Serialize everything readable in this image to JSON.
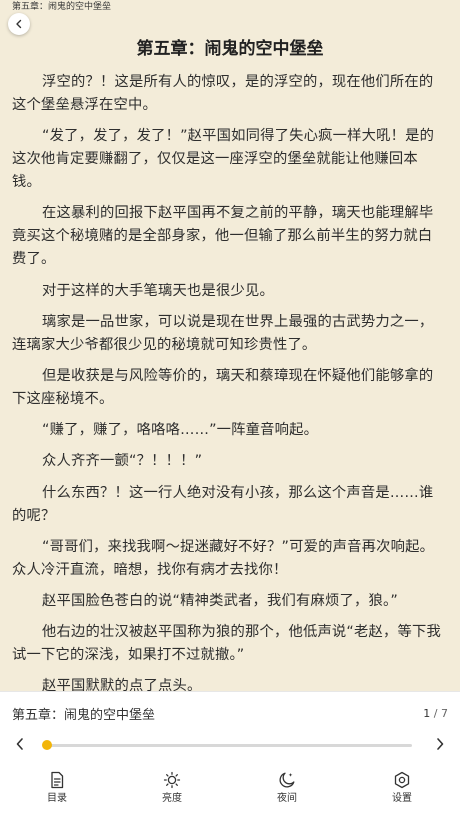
{
  "header": {
    "top_label": "第五章：闹鬼的空中堡垒"
  },
  "chapter": {
    "title": "第五章：闹鬼的空中堡垒",
    "paragraphs": [
      "浮空的？！这是所有人的惊叹，是的浮空的，现在他们所在的这个堡垒悬浮在空中。",
      "“发了，发了，发了！”赵平国如同得了失心疯一样大吼！是的这次他肯定要赚翻了，仅仅是这一座浮空的堡垒就能让他赚回本钱。",
      "在这暴利的回报下赵平国再不复之前的平静，璃天也能理解毕竟买这个秘境赌的是全部身家，他一但输了那么前半生的努力就白费了。",
      "对于这样的大手笔璃天也是很少见。",
      "璃家是一品世家，可以说是现在世界上最强的古武势力之一，连璃家大少爷都很少见的秘境就可知珍贵性了。",
      "但是收获是与风险等价的，璃天和蔡璋现在怀疑他们能够拿的下这座秘境不。",
      "“赚了，赚了，咯咯咯……”一阵童音响起。",
      "众人齐齐一颤“？！！！”",
      "什么东西？！这一行人绝对没有小孩，那么这个声音是……谁的呢？",
      "“哥哥们，来找我啊～捉迷藏好不好？”可爱的声音再次响起。众人冷汗直流，暗想，找你有病才去找你！",
      "赵平国脸色苍白的说“精神类武者，我们有麻烦了，狼。”",
      "他右边的壮汉被赵平国称为狼的那个，他低声说“老赵，等下我试一下它的深浅，如果打不过就撤。”",
      "赵平国默默的点了点头。"
    ]
  },
  "bottom_panel": {
    "chapter_title": "第五章：闹鬼的空中堡垒",
    "page_current": "1",
    "page_total": "/ 7",
    "progress": 0.0,
    "accent_color": "#f2b50a",
    "toolbar": [
      {
        "id": "toc",
        "label": "目录",
        "icon": "toc-icon"
      },
      {
        "id": "brightness",
        "label": "亮度",
        "icon": "brightness-icon"
      },
      {
        "id": "night",
        "label": "夜间",
        "icon": "night-mode-icon"
      },
      {
        "id": "settings",
        "label": "设置",
        "icon": "settings-icon"
      }
    ]
  }
}
